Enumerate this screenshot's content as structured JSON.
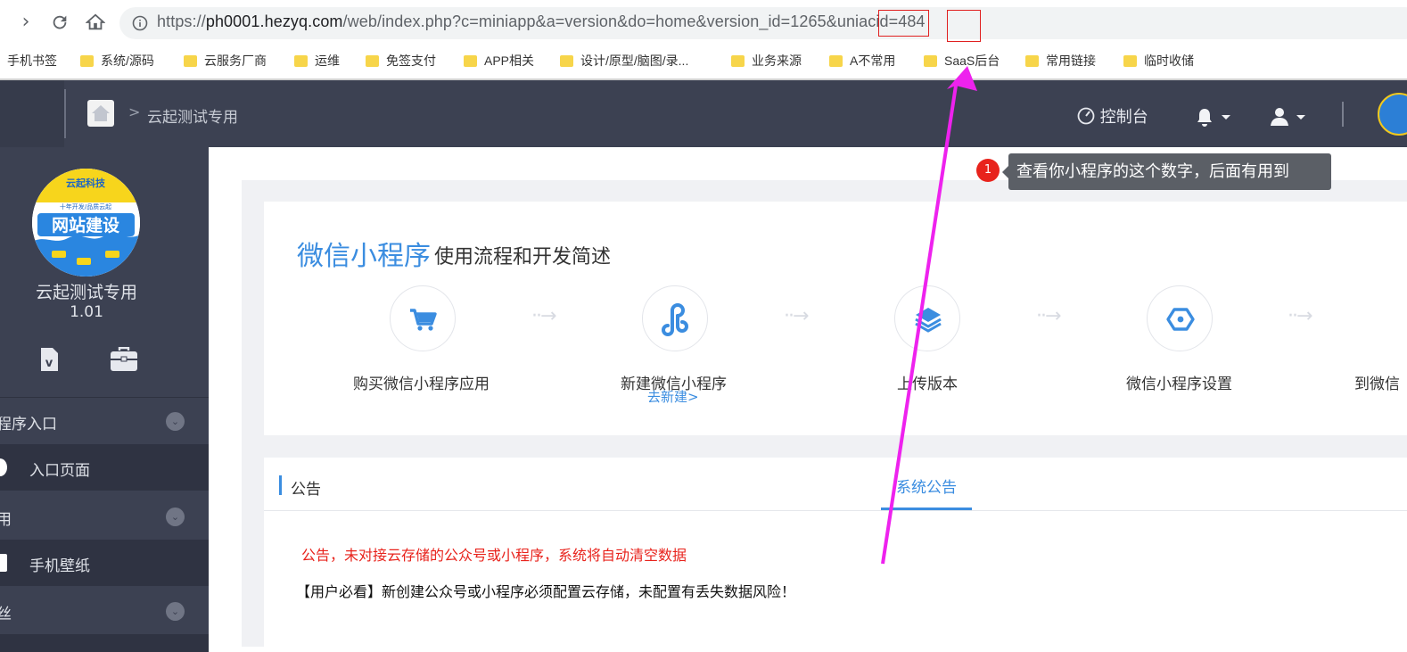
{
  "browser": {
    "url": "https://ph0001.hezyq.com/web/index.php?c=miniapp&a=version&do=home&version_id=1265&uniacid=484",
    "url_parts": {
      "host_prefix": "https://",
      "host": "ph0001.hezyq.com",
      "path": "/web/index.php?c=miniapp&a=version&do=home&version_id=1265&",
      "param_key": "uniacid",
      "equals": "=",
      "param_value": "484"
    },
    "bookmarks": [
      {
        "label": "手机书签",
        "folder": false
      },
      {
        "label": "系统/源码",
        "folder": true
      },
      {
        "label": "云服务厂商",
        "folder": true
      },
      {
        "label": "运维",
        "folder": true
      },
      {
        "label": "免签支付",
        "folder": true
      },
      {
        "label": "APP相关",
        "folder": true
      },
      {
        "label": "设计/原型/脑图/录...",
        "folder": true
      },
      {
        "label": "业务来源",
        "folder": true
      },
      {
        "label": "A不常用",
        "folder": true
      },
      {
        "label": "SaaS后台",
        "folder": true
      },
      {
        "label": "常用链接",
        "folder": true
      },
      {
        "label": "临时收储",
        "folder": true
      }
    ]
  },
  "header": {
    "breadcrumb": "云起测试专用",
    "console_label": "控制台"
  },
  "sidebar": {
    "logo_text": {
      "brand": "云起科技",
      "slogan": "十年开发/品质云起",
      "main": "网站建设"
    },
    "app_name": "云起测试专用",
    "version": "1.01",
    "menu": [
      {
        "type": "group",
        "label": "程序入口"
      },
      {
        "type": "item",
        "label": "入口页面"
      },
      {
        "type": "group",
        "label": "用"
      },
      {
        "type": "item",
        "label": "手机壁纸"
      },
      {
        "type": "group",
        "label": "丝"
      }
    ]
  },
  "flow": {
    "title_accent": "微信小程序",
    "title_rest": "使用流程和开发简述",
    "steps": [
      {
        "label": "购买微信小程序应用",
        "icon": "cart-icon"
      },
      {
        "label": "新建微信小程序",
        "icon": "link-icon",
        "link": "去新建>"
      },
      {
        "label": "上传版本",
        "icon": "layers-icon"
      },
      {
        "label": "微信小程序设置",
        "icon": "hexagon-icon"
      },
      {
        "label": "到微信",
        "icon": "none"
      }
    ]
  },
  "notice": {
    "title": "公告",
    "tab": "系统公告",
    "lines": [
      "公告，未对接云存储的公众号或小程序，系统将自动清空数据",
      "【用户必看】新创建公众号或小程序必须配置云存储，未配置有丢失数据风险！"
    ]
  },
  "tooltip": {
    "badge": "1",
    "text": "查看你小程序的这个数字，后面有用到"
  },
  "colors": {
    "accent": "#3b8de0",
    "header_bg": "#3c4152",
    "warning_red": "#e8231c",
    "annotation_magenta": "#ee22ee"
  }
}
